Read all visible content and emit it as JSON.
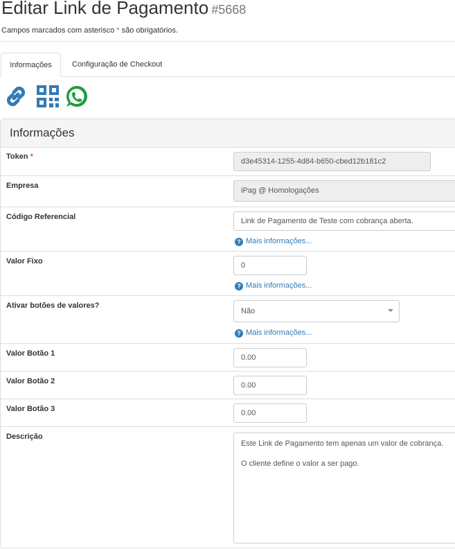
{
  "header": {
    "title": "Editar Link de Pagamento",
    "record_id": "#5668",
    "required_note_prefix": "Campos marcados com asterisco ",
    "required_mark": "*",
    "required_note_suffix": " são obrigatórios."
  },
  "tabs": [
    {
      "label": "Informações",
      "active": true
    },
    {
      "label": "Configuração de Checkout",
      "active": false
    }
  ],
  "action_icons": [
    "link-icon",
    "qr-code-icon",
    "whatsapp-icon"
  ],
  "colors": {
    "link": "#337ab7",
    "whatsapp": "#1f9c3c",
    "required": "#d9534f"
  },
  "panel": {
    "title": "Informações"
  },
  "form": {
    "token": {
      "label": "Token",
      "required_mark": "*",
      "value": "d3e45314-1255-4d84-b650-cbed12b181c2"
    },
    "empresa": {
      "label": "Empresa",
      "value": "iPag @ Homologações"
    },
    "codigo_referencial": {
      "label": "Código Referencial",
      "value": "Link de Pagamento de Teste com cobrança aberta.",
      "help": "Mais informações..."
    },
    "valor_fixo": {
      "label": "Valor Fixo",
      "value": "0",
      "help": "Mais informações..."
    },
    "ativar_botoes": {
      "label": "Ativar botões de valores?",
      "value": "Não",
      "help": "Mais informações..."
    },
    "valor_botao_1": {
      "label": "Valor Botão 1",
      "value": "0.00"
    },
    "valor_botao_2": {
      "label": "Valor Botão 2",
      "value": "0.00"
    },
    "valor_botao_3": {
      "label": "Valor Botão 3",
      "value": "0.00"
    },
    "descricao": {
      "label": "Descrição",
      "line1": "Este Link de Pagamento tem apenas um valor de cobrança.",
      "line2": "O cliente define o valor a ser pago."
    }
  }
}
